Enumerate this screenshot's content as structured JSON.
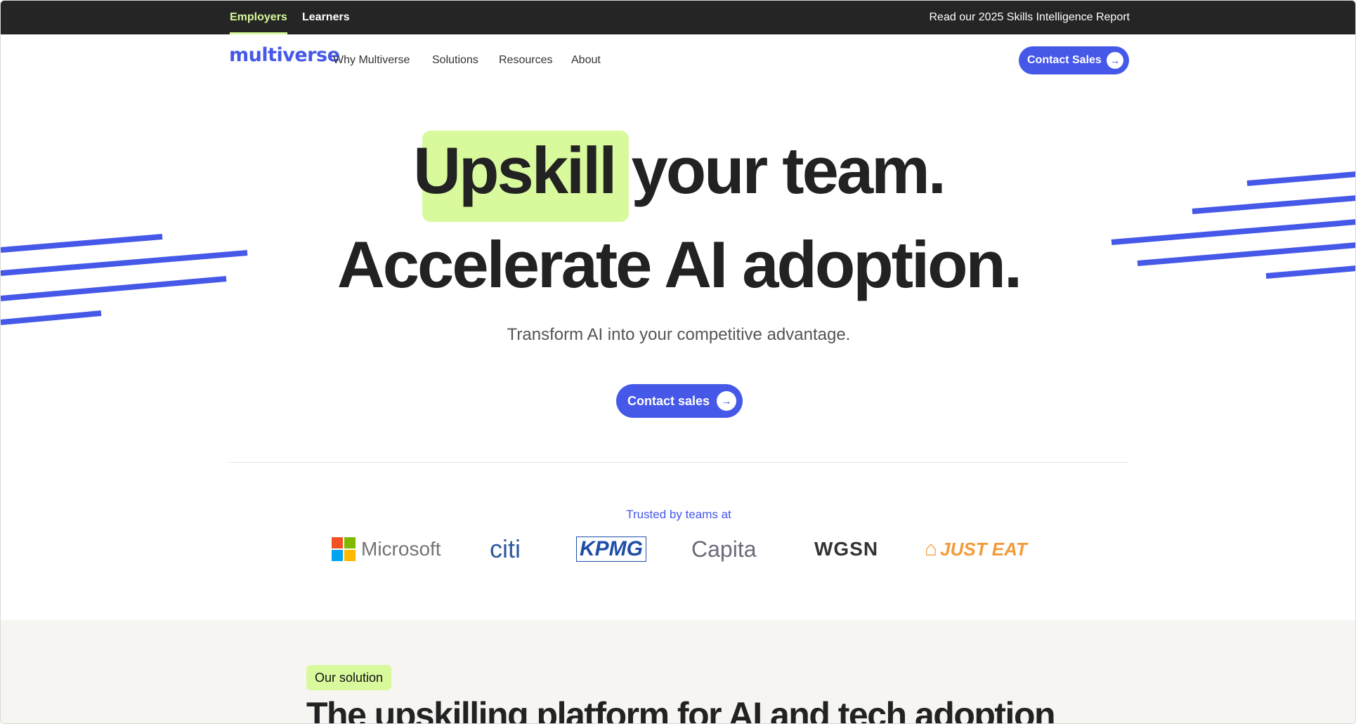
{
  "topbar": {
    "audiences": [
      "Employers",
      "Learners"
    ],
    "report_link": "Read our 2025 Skills Intelligence Report"
  },
  "nav": {
    "logo": "multiverse",
    "links": [
      "Why Multiverse",
      "Solutions",
      "Resources",
      "About"
    ],
    "cta": "Contact Sales"
  },
  "hero": {
    "highlight_word": "Upskill",
    "line1_rest": "your team.",
    "line2": "Accelerate AI adoption.",
    "subtitle": "Transform AI into your competitive advantage.",
    "cta": "Contact sales"
  },
  "trusted": {
    "label": "Trusted by teams at",
    "brands": [
      "Microsoft",
      "citi",
      "KPMG",
      "Capita",
      "WGSN",
      "JUST EAT"
    ]
  },
  "solution": {
    "badge": "Our solution",
    "title": "The upskilling platform for AI and tech adoption"
  },
  "colors": {
    "accent": "#4558e8",
    "highlight": "#d9f99d",
    "topbar": "#252525"
  },
  "icons": [
    "arrow-right-icon",
    "microsoft-logo",
    "citi-logo",
    "kpmg-logo",
    "capita-logo",
    "wgsn-logo",
    "justeat-logo"
  ]
}
